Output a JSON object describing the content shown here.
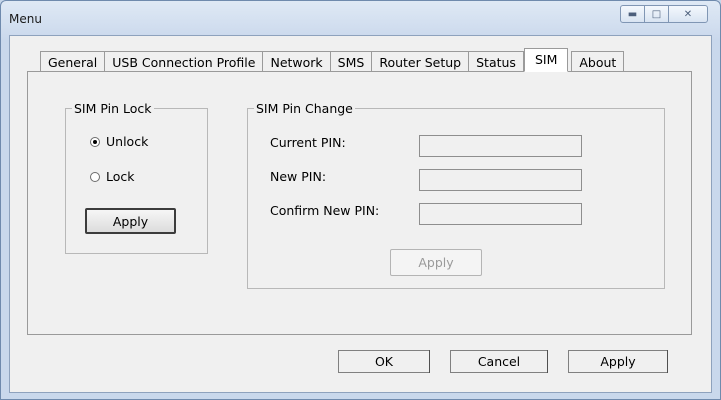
{
  "window": {
    "title": "Menu",
    "caption_icons": [
      "minimize-icon",
      "maximize-icon",
      "close-icon"
    ]
  },
  "tabs": [
    {
      "label": "General",
      "active": false
    },
    {
      "label": "USB Connection Profile",
      "active": false
    },
    {
      "label": "Network",
      "active": false
    },
    {
      "label": "SMS",
      "active": false
    },
    {
      "label": "Router Setup",
      "active": false
    },
    {
      "label": "Status",
      "active": false
    },
    {
      "label": "SIM",
      "active": true
    },
    {
      "label": "About",
      "active": false
    }
  ],
  "sim_pin_lock": {
    "legend": "SIM Pin Lock",
    "options": [
      {
        "label": "Unlock",
        "checked": true
      },
      {
        "label": "Lock",
        "checked": false
      }
    ],
    "apply_label": "Apply"
  },
  "sim_pin_change": {
    "legend": "SIM Pin Change",
    "current_pin_label": "Current PIN:",
    "current_pin_value": "",
    "new_pin_label": "New PIN:",
    "new_pin_value": "",
    "confirm_pin_label": "Confirm New PIN:",
    "confirm_pin_value": "",
    "apply_label": "Apply"
  },
  "footer": {
    "ok_label": "OK",
    "cancel_label": "Cancel",
    "apply_label": "Apply"
  }
}
